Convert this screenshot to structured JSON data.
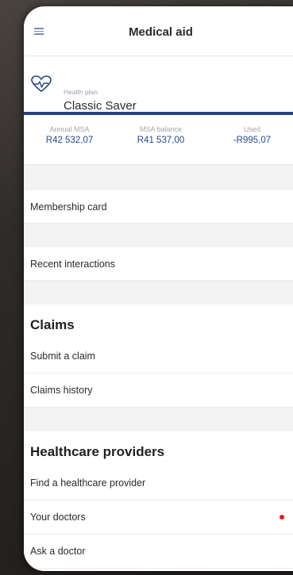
{
  "header": {
    "title": "Medical aid",
    "menu_icon": "hamburger-menu-icon"
  },
  "plan": {
    "icon": "heart-pulse-icon",
    "label": "Health plan",
    "name": "Classic Saver"
  },
  "stats": [
    {
      "label": "Annual MSA",
      "value": "R42 532,07"
    },
    {
      "label": "MSA balance",
      "value": "R41 537,00"
    },
    {
      "label": "Used",
      "value": "-R995,07"
    }
  ],
  "rows": {
    "membership_card": "Membership card",
    "recent_interactions": "Recent interactions"
  },
  "claims": {
    "title": "Claims",
    "submit": "Submit a claim",
    "history": "Claims history"
  },
  "providers": {
    "title": "Healthcare providers",
    "find": "Find a healthcare provider",
    "doctors": "Your doctors",
    "ask": "Ask a doctor"
  },
  "colors": {
    "accent": "#274580",
    "value_text": "#264b8c",
    "notification_dot": "#e31d24",
    "menu_icon": "#7b8bb3"
  }
}
